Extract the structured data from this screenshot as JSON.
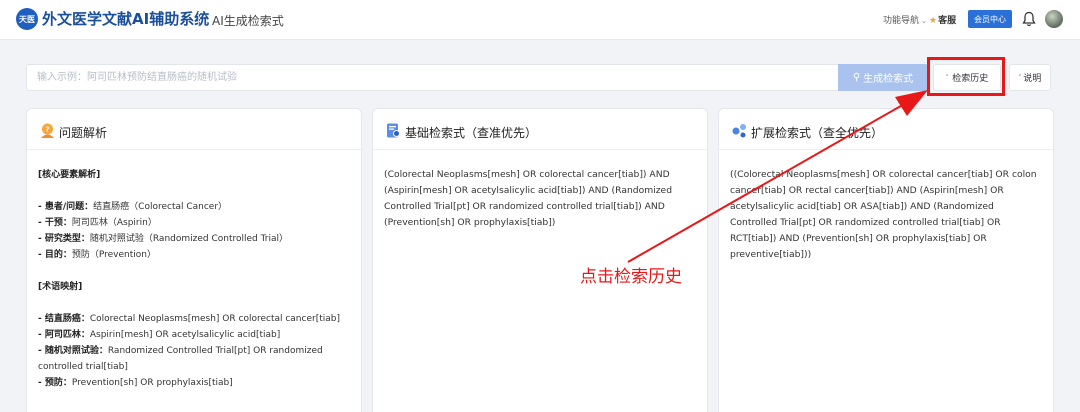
{
  "header": {
    "logo_text": "天医",
    "app_title": "外文医学文献AI辅助系统",
    "page_title": "AI生成检索式",
    "nav_menu": "功能导航",
    "service": "客服",
    "member_center": "会员中心"
  },
  "search": {
    "placeholder": "输入示例：阿司匹林预防结直肠癌的随机试验",
    "generate_button": "生成检索式",
    "history_button": "检索历史",
    "help_button": "说明"
  },
  "panels": {
    "analysis": {
      "title": "问题解析",
      "lines": [
        {
          "bold": "[核心要素解析]",
          "text": ""
        },
        {
          "bold": "",
          "text": ""
        },
        {
          "bold": "- 患者/问题：",
          "text": "结直肠癌（Colorectal Cancer）"
        },
        {
          "bold": "- 干预：",
          "text": "阿司匹林（Aspirin）"
        },
        {
          "bold": "- 研究类型：",
          "text": "随机对照试验（Randomized Controlled Trial）"
        },
        {
          "bold": "- 目的：",
          "text": "预防（Prevention）"
        },
        {
          "bold": "",
          "text": ""
        },
        {
          "bold": "[术语映射]",
          "text": ""
        },
        {
          "bold": "",
          "text": ""
        },
        {
          "bold": "- 结直肠癌：",
          "text": "Colorectal Neoplasms[mesh] OR colorectal cancer[tiab]"
        },
        {
          "bold": "- 阿司匹林：",
          "text": "Aspirin[mesh] OR acetylsalicylic acid[tiab]"
        },
        {
          "bold": "- 随机对照试验：",
          "text": "Randomized Controlled Trial[pt] OR randomized"
        },
        {
          "bold": "",
          "text": "controlled trial[tiab]"
        },
        {
          "bold": "- 预防：",
          "text": "Prevention[sh] OR prophylaxis[tiab]"
        }
      ]
    },
    "basic": {
      "title": "基础检索式（查准优先）",
      "query": "(Colorectal Neoplasms[mesh] OR colorectal cancer[tiab]) AND (Aspirin[mesh] OR acetylsalicylic acid[tiab]) AND (Randomized Controlled Trial[pt] OR randomized controlled trial[tiab]) AND (Prevention[sh] OR prophylaxis[tiab])"
    },
    "extended": {
      "title": "扩展检索式（查全优先）",
      "query": "((Colorectal Neoplasms[mesh] OR colorectal cancer[tiab] OR colon cancer[tiab] OR rectal cancer[tiab]) AND (Aspirin[mesh] OR acetylsalicylic acid[tiab] OR ASA[tiab]) AND (Randomized Controlled Trial[pt] OR randomized controlled trial[tiab] OR RCT[tiab]) AND (Prevention[sh] OR prophylaxis[tiab] OR preventive[tiab]))"
    }
  },
  "annotation": {
    "text": "点击检索历史",
    "color": "#e81818"
  },
  "colors": {
    "brand": "#1a4f9c",
    "primary_button": "#2b6fd8",
    "generate_button": "#a9c3ee"
  }
}
